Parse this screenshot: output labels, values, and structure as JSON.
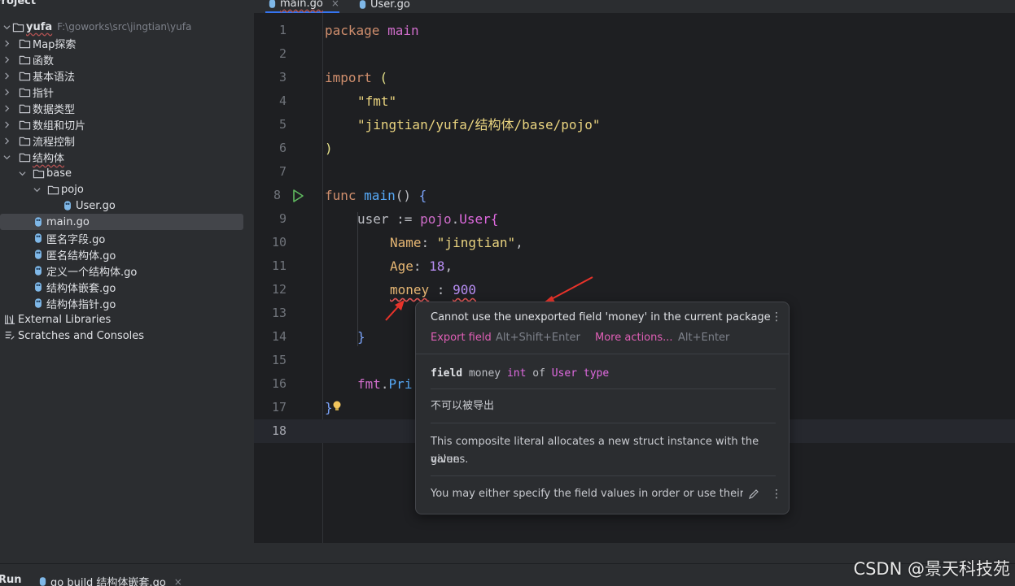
{
  "sidebar": {
    "header": "Project",
    "root": {
      "name": "yufa",
      "path": "F:\\goworks\\src\\jingtian\\yufa"
    },
    "folders": [
      "Map探索",
      "函数",
      "基本语法",
      "指针",
      "数据类型",
      "数组和切片",
      "流程控制",
      "结构体"
    ],
    "base_folder": "base",
    "pojo_folder": "pojo",
    "user_file": "User.go",
    "files": [
      "main.go",
      "匿名字段.go",
      "匿名结构体.go",
      "定义一个结构体.go",
      "结构体嵌套.go",
      "结构体指针.go"
    ],
    "external_libraries": "External Libraries",
    "scratches": "Scratches and Consoles"
  },
  "tabs": [
    {
      "label": "main.go",
      "close": "×"
    },
    {
      "label": "User.go"
    }
  ],
  "code": {
    "line_numbers": [
      "1",
      "2",
      "3",
      "4",
      "5",
      "6",
      "7",
      "8",
      "9",
      "10",
      "11",
      "12",
      "13",
      "14",
      "15",
      "16",
      "17",
      "18"
    ],
    "l1_kw": "package",
    "l1_name": "main",
    "l3_kw": "import",
    "l3_paren": "(",
    "l4_str": "\"fmt\"",
    "l5_str": "\"jingtian/yufa/结构体/base/pojo\"",
    "l6_paren": ")",
    "l8_kw": "func",
    "l8_name": "main",
    "l8_rest": "()",
    "l8_brace": "{",
    "l9_var": "user",
    "l9_op": " := ",
    "l9_pkg": "pojo",
    "l9_dot": ".",
    "l9_type": "User",
    "l9_brace": "{",
    "l10_field": "Name",
    "l10_colon": ": ",
    "l10_val": "\"jingtian\"",
    "l10_comma": ",",
    "l11_field": "Age",
    "l11_colon": ": ",
    "l11_val": "18",
    "l11_comma": ",",
    "l12_field": "money",
    "l12_colon": " : ",
    "l12_val": "900",
    "l14_brace": "}",
    "l16_pkg": "fmt",
    "l16_dot": ".",
    "l16_fn": "Pri",
    "l17_brace": "}"
  },
  "popup": {
    "message": "Cannot use the unexported field 'money' in the current package",
    "action1": "Export field",
    "action1_shortcut": "Alt+Shift+Enter",
    "action2": "More actions...",
    "action2_shortcut": "Alt+Enter",
    "sig_kw": "field",
    "sig_name": " money ",
    "sig_type": "int",
    "sig_of": " of ",
    "sig_owner": "User",
    "sig_type_kw": " type",
    "doc_comment": "不可以被导出",
    "doc_line1": "This composite literal allocates a new struct instance with the given",
    "doc_line2": "values.",
    "doc_hint": "You may either specify the field values in order or use their nar",
    "kebab": "⋮"
  },
  "bottom": {
    "run_label": "Run",
    "run_tab": "go build 结构体嵌套.go",
    "run_close": "×"
  },
  "watermark": "CSDN @景天科技苑",
  "colors": {
    "accent": "#3574f0",
    "error": "#e05555",
    "arrow": "#e8332a",
    "link": "#e05fb6"
  }
}
